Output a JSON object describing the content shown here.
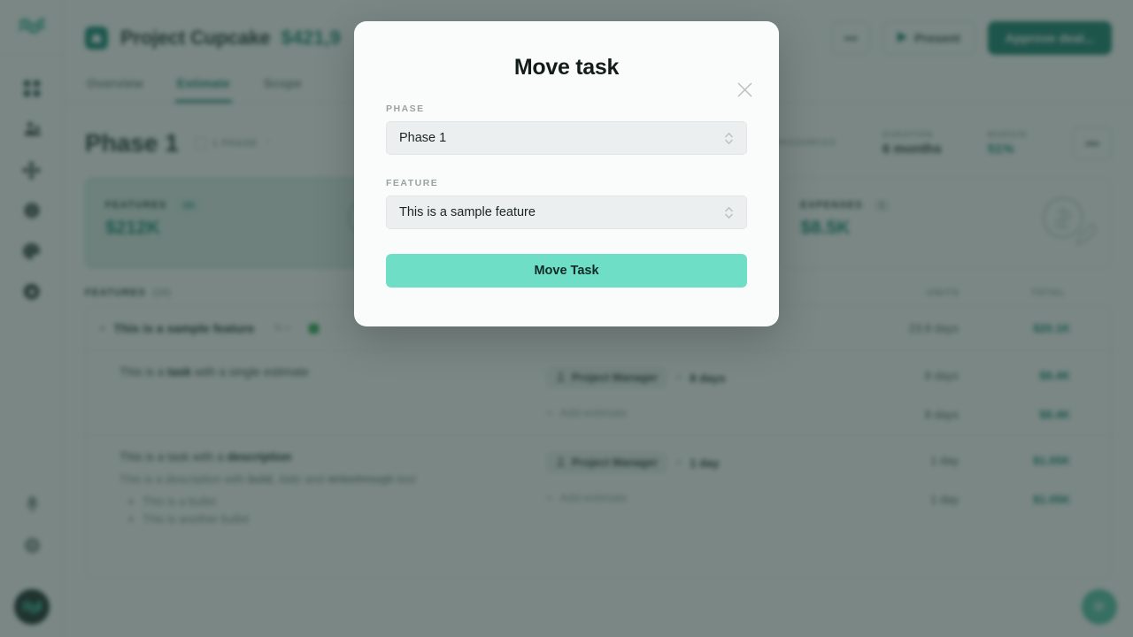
{
  "sidebar": {
    "logo_icon": "wave-logo-icon",
    "items": [
      {
        "icon": "grid-dashboard-icon",
        "name": "dashboard"
      },
      {
        "icon": "people-icon",
        "name": "people"
      },
      {
        "icon": "network-nodes-icon",
        "name": "network"
      },
      {
        "icon": "globe-icon",
        "name": "globe"
      },
      {
        "icon": "palette-icon",
        "name": "palette"
      },
      {
        "icon": "gear-icon",
        "name": "settings"
      }
    ],
    "bottom_items": [
      {
        "icon": "bell-icon",
        "name": "notifications"
      },
      {
        "icon": "help-circle-icon",
        "name": "help"
      }
    ],
    "avatar_icon": "wave-avatar-icon"
  },
  "header": {
    "project_icon": "project-cube-icon",
    "project_title": "Project Cupcake",
    "project_amount": "$421,9",
    "more_label": "•••",
    "present_label": "Present",
    "approve_label": "Approve deal..."
  },
  "tabs": [
    {
      "label": "Overview",
      "active": false
    },
    {
      "label": "Estimate",
      "active": true
    },
    {
      "label": "Scope",
      "active": false
    }
  ],
  "phase": {
    "title": "Phase 1",
    "badge_label": "1 PHASE",
    "metrics": [
      {
        "label": "RESOURCES",
        "value": "",
        "teal": false
      },
      {
        "label": "DURATION",
        "value": "6 months",
        "teal": false
      },
      {
        "label": "MARGIN",
        "value": "51%",
        "teal": true
      }
    ],
    "more_label": "•••"
  },
  "cards": [
    {
      "label": "FEATURES",
      "count": "10",
      "value": "$212K",
      "selected": true,
      "art": "coin-wrench-icon"
    },
    {
      "label": "",
      "count": "",
      "value": "",
      "selected": false,
      "art": "coin-refresh-icon"
    },
    {
      "label": "EXPENSES",
      "count": "1",
      "value": "$8.5K",
      "selected": false,
      "art": "coin-pencil-icon"
    }
  ],
  "list": {
    "heading": "FEATURES",
    "heading_count": "(10)",
    "col_units": "UNITS",
    "col_total": "TOTAL"
  },
  "feature_row": {
    "chevron_icon": "chevron-down-icon",
    "name": "This is a sample feature",
    "percent_chip": "% ×",
    "flag_icon": "green-flag-icon",
    "extra_icon": "dots-icon",
    "units": "23.8 days",
    "total": "$20.1K"
  },
  "tasks": [
    {
      "title_prefix": "This is a ",
      "title_bold": "task",
      "title_suffix": " with a single estimate",
      "description": "",
      "bullets": [],
      "role": "Project Manager",
      "role_icon": "person-icon",
      "times": "×",
      "qty": "8 days",
      "add_estimate": "Add estimate",
      "add_icon": "plus-icon",
      "units": "8 days",
      "total": "$8.4K",
      "units2": "8 days",
      "total2": "$8.4K"
    },
    {
      "title_prefix": "This is a task with a ",
      "title_bold": "description",
      "title_suffix": "",
      "description_pre": "This is a description with ",
      "description_bold": "bold",
      "description_mid": ", ",
      "description_italic": "italic",
      "description_mid2": " and ",
      "description_strike": "strikethrough",
      "description_post": " text",
      "bullets": [
        "This is a bullet",
        "This is another bullet"
      ],
      "role": "Project Manager",
      "role_icon": "person-icon",
      "times": "×",
      "qty": "1 day",
      "add_estimate": "Add estimate",
      "add_icon": "plus-icon",
      "units": "1 day",
      "total": "$1.05K",
      "units2": "1 day",
      "total2": "$1.05K"
    }
  ],
  "chat": {
    "icon": "chat-bubble-icon"
  },
  "modal": {
    "title": "Move task",
    "close_icon": "close-icon",
    "phase_label": "PHASE",
    "phase_value": "Phase 1",
    "feature_label": "FEATURE",
    "feature_value": "This is a sample feature",
    "submit_label": "Move Task",
    "caret_icon": "chevron-updown-icon"
  },
  "colors": {
    "accent_teal": "#0e8573",
    "mint_button": "#6fdec6",
    "overlay": "#28433a",
    "card_selected_bg": "#dff0ea"
  }
}
